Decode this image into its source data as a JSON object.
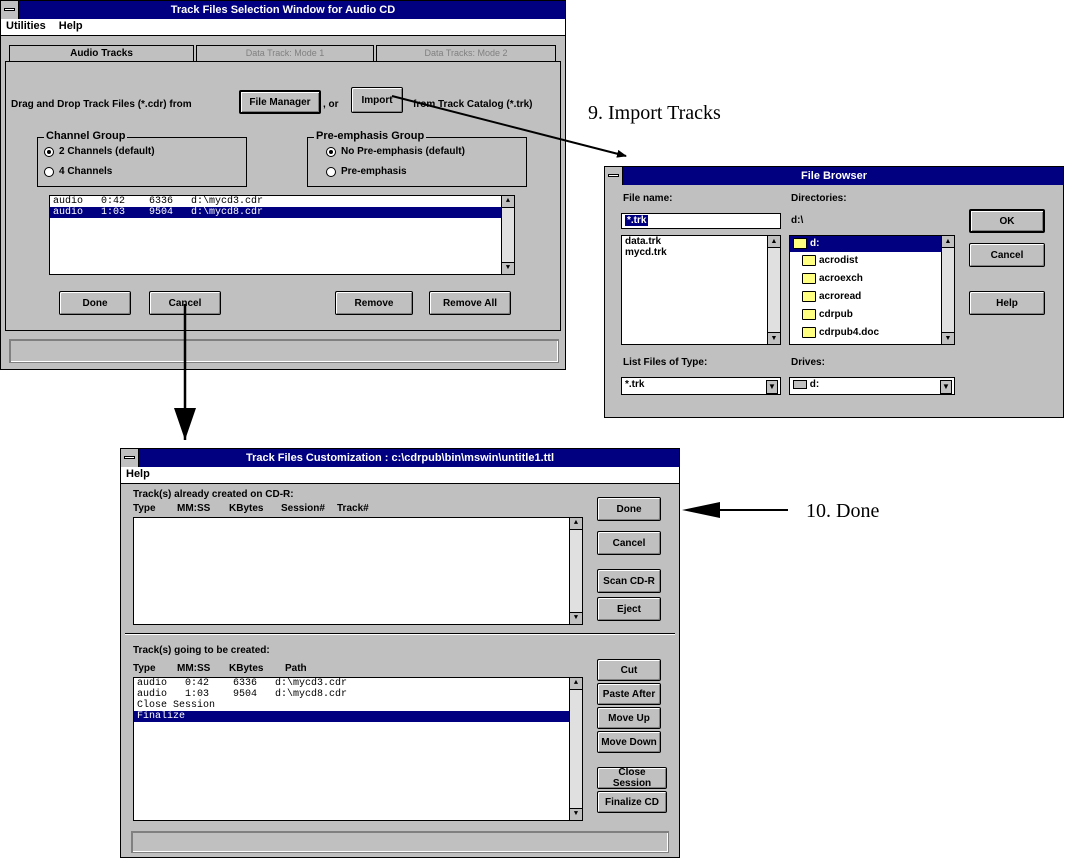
{
  "track_selection": {
    "title": "Track Files Selection Window for Audio CD",
    "menu": [
      "Utilities",
      "Help"
    ],
    "tabs": [
      "Audio Tracks",
      "Data Track: Mode 1",
      "Data Tracks: Mode 2"
    ],
    "drag_text": "Drag and Drop Track Files (*.cdr) from",
    "file_manager_button": "File Manager",
    "or_text": ", or",
    "import_button": "Import",
    "from_catalog_text": "from Track Catalog (*.trk)",
    "channel_group": {
      "title": "Channel Group",
      "options": [
        "2 Channels (default)",
        "4 Channels"
      ],
      "selected": "2 Channels (default)"
    },
    "preemphasis_group": {
      "title": "Pre-emphasis Group",
      "options": [
        "No Pre-emphasis (default)",
        "Pre-emphasis"
      ],
      "selected": "No Pre-emphasis (default)"
    },
    "tracks": [
      "audio   0:42    6336   d:\\mycd3.cdr",
      "audio   1:03    9504   d:\\mycd8.cdr"
    ],
    "buttons": {
      "done": "Done",
      "cancel": "Cancel",
      "remove": "Remove",
      "remove_all": "Remove All"
    }
  },
  "file_browser": {
    "title": "File Browser",
    "filename_label": "File name:",
    "filename_value": "*.trk",
    "files": [
      "data.trk",
      "mycd.trk"
    ],
    "directories_label": "Directories:",
    "current_dir": "d:\\",
    "dirs": [
      "d:",
      "acrodist",
      "acroexch",
      "acroread",
      "cdrpub",
      "cdrpub4.doc"
    ],
    "list_type_label": "List Files of Type:",
    "list_type_value": "*.trk",
    "drives_label": "Drives:",
    "drive_value": "d:",
    "buttons": {
      "ok": "OK",
      "cancel": "Cancel",
      "help": "Help"
    }
  },
  "customization": {
    "title": "Track Files Customization : c:\\cdrpub\\bin\\mswin\\untitle1.ttl",
    "menu": [
      "Help"
    ],
    "created_label": "Track(s) already created on CD-R:",
    "created_headers": [
      "Type",
      "MM:SS",
      "KBytes",
      "Session#",
      "Track#"
    ],
    "created_rows": [],
    "pending_label": "Track(s) going to be created:",
    "pending_headers": [
      "Type",
      "MM:SS",
      "KBytes",
      "Path"
    ],
    "pending_rows": [
      "audio   0:42    6336   d:\\mycd3.cdr",
      "audio   1:03    9504   d:\\mycd8.cdr",
      "Close Session",
      "Finalize"
    ],
    "selected_pending": "Finalize",
    "buttons": {
      "done": "Done",
      "cancel": "Cancel",
      "scan": "Scan CD-R",
      "eject": "Eject",
      "cut": "Cut",
      "paste_after": "Paste After",
      "move_up": "Move Up",
      "move_down": "Move Down",
      "close_session": "Close Session",
      "finalize_cd": "Finalize CD"
    }
  },
  "annotations": {
    "import_tracks": "9. Import Tracks",
    "done": "10. Done"
  }
}
